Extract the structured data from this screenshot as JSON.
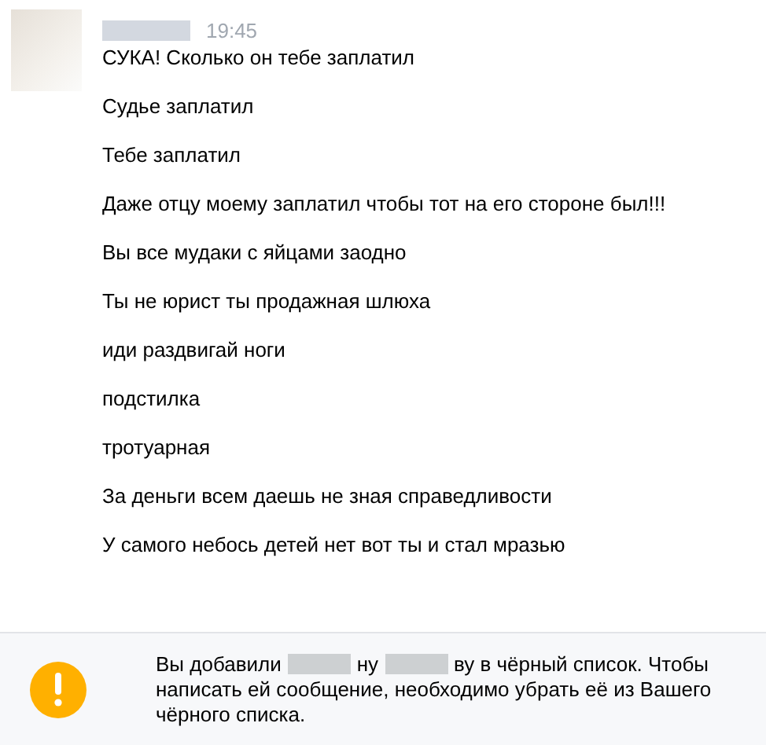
{
  "message": {
    "time": "19:45",
    "lines": [
      "СУКА! Сколько он тебе заплатил",
      "Судье заплатил",
      "Тебе заплатил",
      "Даже отцу моему заплатил чтобы тот на его стороне был!!!",
      "Вы все мудаки с яйцами заодно",
      "Ты не юрист ты продажная шлюха",
      "иди раздвигай ноги",
      "подстилка",
      "тротуарная",
      "За деньги всем даешь не зная справедливости",
      "У самого небось детей нет вот ты и стал мразью"
    ]
  },
  "notice": {
    "parts": [
      {
        "kind": "text",
        "text": "Вы добавили"
      },
      {
        "kind": "redacted"
      },
      {
        "kind": "text",
        "text": "ну"
      },
      {
        "kind": "redacted"
      },
      {
        "kind": "text",
        "text": "ву в чёрный список. Чтобы"
      },
      {
        "kind": "continuation",
        "text": "написать ей сообщение, необходимо убрать её из Вашего чёрного списка."
      }
    ]
  }
}
